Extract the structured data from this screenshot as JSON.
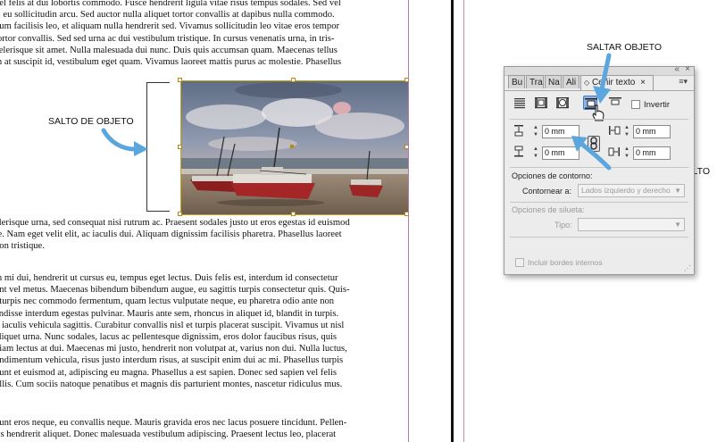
{
  "document": {
    "p1": [
      "vel felis at dui lobortis commodo. Fusce hendrerit ligula vitae risus tempus sodales. Sed vel",
      "s, eu sollicitudin arcu. Sed auctor nulla aliquet tortor convallis at dapibus nulla commodo.",
      "dum facilisis leo, et aliquam nulla hendrerit sed. Vivamus sollicitudin leo vitae eros tempor",
      " tortor convallis. Sed sed urna ac dui vestibulum tristique. In cursus venenatis urna, in tris-",
      "celerisque sit amet. Nulla malesuada dui nunc. Duis quis accumsan quam. Maecenas tellus",
      "m at suscipit id, vestibulum eget quam. Vivamus laoreet mattis purus ac molestie. Phasellus"
    ],
    "p2": [
      "elerisque urna, sed consequat nisi rutrum ac. Praesent sodales justo ut eros egestas id euismod",
      "re. Nam eget velit elit, ac iaculis dui. Aliquam dignissim facilisis pharetra. Phasellus laoreet",
      "non tristique."
    ],
    "p3": [
      "m mi dui, hendrerit ut cursus eu, tempus eget lectus. Duis felis est, interdum id consectetur",
      "unt vel metus. Maecenas bibendum bibendum augue, eu sagittis turpis consectetur quis. Quis-",
      ", turpis nec commodo fermentum, quam lectus vulputate neque, eu pharetra odio ante non",
      "endisse interdum egestas pulvinar. Mauris ante sem, rhoncus in aliquet id, blandit in turpis.",
      "n iaculis vehicula sagittis. Curabitur convallis nisl et turpis placerat suscipit. Vivamus ut nisl",
      " aliquet urna. Nunc sodales, lacus ac pellentesque dignissim, eros dolor faucibus risus, quis",
      "diam lectus at dui. Maecenas mi justo, hendrerit non volutpat at, varius non dui. Nulla luctus,",
      "ondimentum vehicula, risus justo interdum risus, at suscipit enim dui ac mi. Phasellus turpis",
      "dunt et euismod at, adipiscing eu magna. Phasellus a est sapien. Donec sed sapien vel felis",
      "ollis. Cum sociis natoque penatibus et magnis dis parturient montes, nascetur ridiculus mus."
    ],
    "p4": [
      "dunt eros neque, eu convallis neque. Mauris gravida eros nec lacus posuere tincidunt. Pellen-",
      "ris hendrerit aliquet. Donec malesuada vestibulum adipiscing. Praesent lectus leo, placerat"
    ]
  },
  "annotations": {
    "salto_objeto": "SALTO DE OBJETO",
    "saltar_objeto": "SALTAR OBJETO",
    "cantidad_salto": "CANTIDAD DEL SALTO"
  },
  "panel": {
    "tabs": [
      "Bu",
      "Tra",
      "Na",
      "Ali",
      "C"
    ],
    "active_tab_label": "Ceñir texto",
    "close_glyph": "×",
    "invertir_label": "Invertir",
    "offsets": {
      "top": "0 mm",
      "bottom": "0 mm",
      "left": "0 mm",
      "right": "0 mm"
    },
    "contorno_heading": "Opciones de contorno:",
    "contornear_label": "Contornear a:",
    "contornear_value": "Lados izquierdo y derecho",
    "silueta_heading": "Opciones de silueta:",
    "tipo_label": "Tipo:",
    "tipo_value": "",
    "incluir_label": "Incluir bordes internos"
  },
  "colors": {
    "arrow_blue": "#5aa6dd",
    "selection_blue": "#8fb4e6",
    "frame_gold": "#c9a21b"
  },
  "icons": {
    "wrap_none": "no-wrap-icon",
    "wrap_bbox": "bounding-box-wrap-icon",
    "wrap_shape": "object-shape-wrap-icon",
    "wrap_jump": "jump-object-icon",
    "wrap_next_column": "jump-next-column-icon",
    "link": "chain-link-icon",
    "cursor": "hand-cursor-icon"
  }
}
